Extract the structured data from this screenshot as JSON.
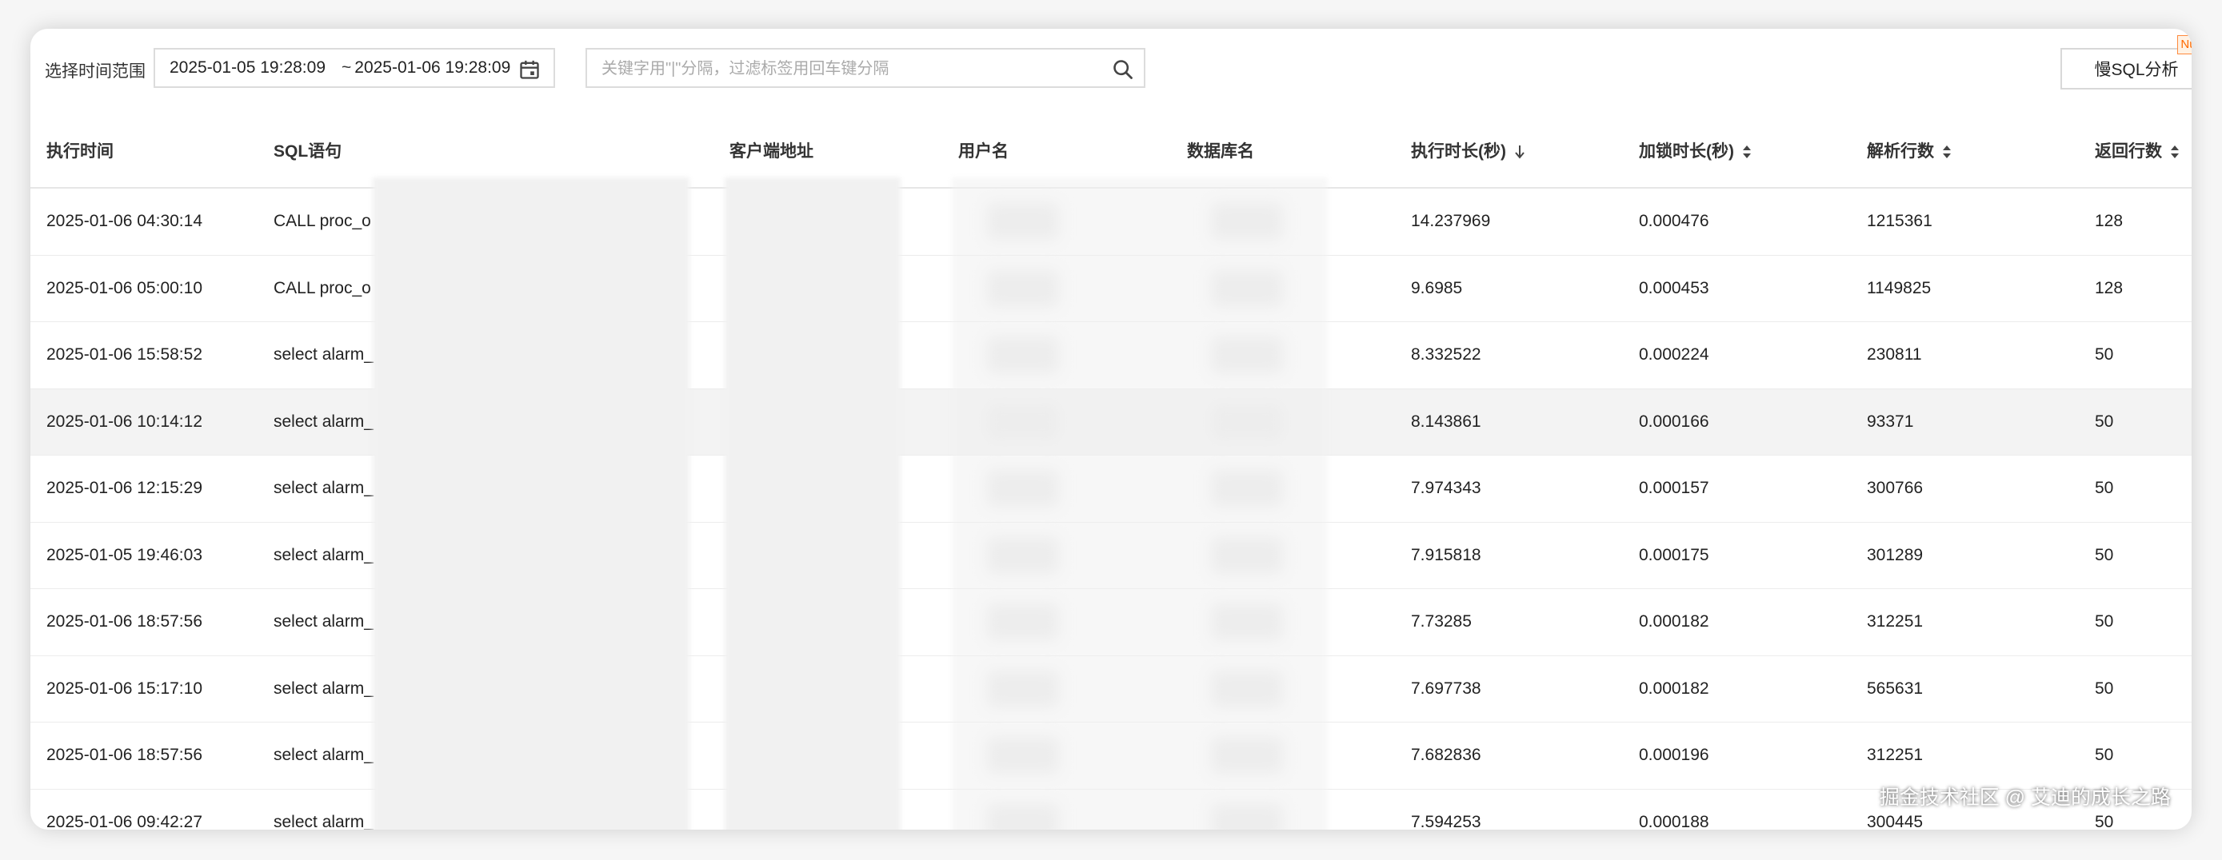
{
  "toolbar": {
    "range_label": "选择时间范围",
    "start_time": "2025-01-05 19:28:09",
    "separator": "~",
    "end_time": "2025-01-06 19:28:09",
    "search_placeholder": "关键字用\"|\"分隔，过滤标签用回车键分隔",
    "slow_sql_button": "慢SQL分析",
    "new_badge": "Nu"
  },
  "table": {
    "columns": {
      "exec_time": "执行时间",
      "sql": "SQL语句",
      "client": "客户端地址",
      "user": "用户名",
      "db": "数据库名",
      "duration": "执行时长(秒)",
      "lock": "加锁时长(秒)",
      "parsed": "解析行数",
      "returned": "返回行数"
    },
    "rows": [
      {
        "time": "2025-01-06 04:30:14",
        "sql": "CALL proc_o",
        "duration": "14.237969",
        "lock": "0.000476",
        "parsed": "1215361",
        "returned": "128"
      },
      {
        "time": "2025-01-06 05:00:10",
        "sql": "CALL proc_o",
        "duration": "9.6985",
        "lock": "0.000453",
        "parsed": "1149825",
        "returned": "128"
      },
      {
        "time": "2025-01-06 15:58:52",
        "sql": "select alarm_",
        "duration": "8.332522",
        "lock": "0.000224",
        "parsed": "230811",
        "returned": "50"
      },
      {
        "time": "2025-01-06 10:14:12",
        "sql": "select alarm_",
        "duration": "8.143861",
        "lock": "0.000166",
        "parsed": "93371",
        "returned": "50"
      },
      {
        "time": "2025-01-06 12:15:29",
        "sql": "select alarm_",
        "duration": "7.974343",
        "lock": "0.000157",
        "parsed": "300766",
        "returned": "50"
      },
      {
        "time": "2025-01-05 19:46:03",
        "sql": "select alarm_",
        "duration": "7.915818",
        "lock": "0.000175",
        "parsed": "301289",
        "returned": "50"
      },
      {
        "time": "2025-01-06 18:57:56",
        "sql": "select alarm_",
        "duration": "7.73285",
        "lock": "0.000182",
        "parsed": "312251",
        "returned": "50"
      },
      {
        "time": "2025-01-06 15:17:10",
        "sql": "select alarm_",
        "duration": "7.697738",
        "lock": "0.000182",
        "parsed": "565631",
        "returned": "50"
      },
      {
        "time": "2025-01-06 18:57:56",
        "sql": "select alarm_",
        "duration": "7.682836",
        "lock": "0.000196",
        "parsed": "312251",
        "returned": "50"
      },
      {
        "time": "2025-01-06 09:42:27",
        "sql": "select alarm_",
        "duration": "7.594253",
        "lock": "0.000188",
        "parsed": "300445",
        "returned": "50"
      }
    ]
  },
  "watermark": "掘金技术社区 @ 艾迪的成长之路",
  "icons": {
    "calendar": "calendar-icon",
    "search": "search-icon",
    "sort_desc": "sort-desc-icon",
    "sort_both": "sort-icon",
    "copy": "copy-icon"
  },
  "colors": {
    "text": "#222222",
    "border": "#dcdcdc",
    "highlight_row": "#f3f3f3",
    "badge": "#ff6a00"
  }
}
